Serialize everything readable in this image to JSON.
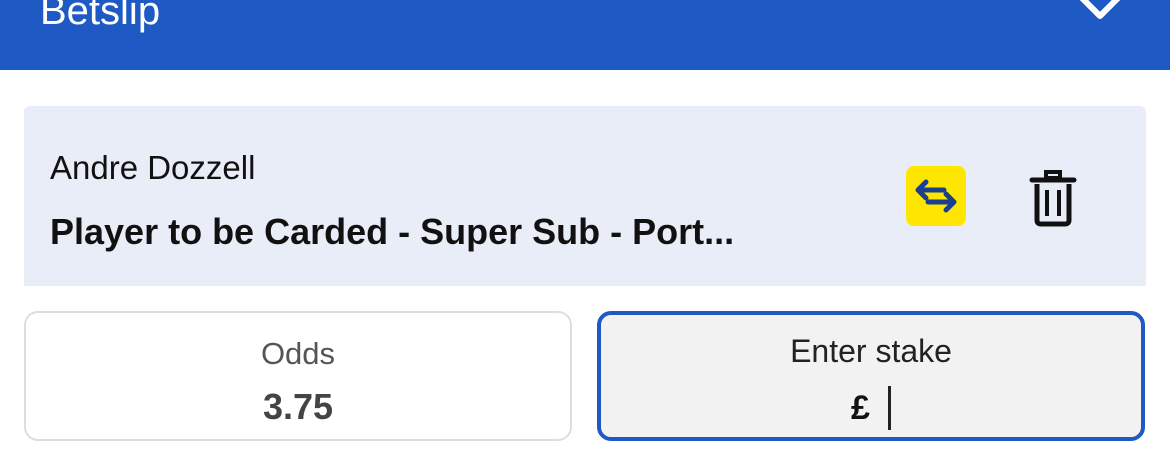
{
  "header": {
    "title": "Betslip",
    "collapse_icon": "chevron-down-icon",
    "background": "#1f5ac4"
  },
  "bet": {
    "selection": "Andre Dozzell",
    "market": "Player to be Carded - Super Sub - Port...",
    "swap_icon": "swap-arrows-icon",
    "swap_color": "#ffe600",
    "delete_icon": "trash-icon"
  },
  "odds": {
    "label": "Odds",
    "value": "3.75"
  },
  "stake": {
    "label": "Enter stake",
    "currency": "£",
    "value": ""
  }
}
